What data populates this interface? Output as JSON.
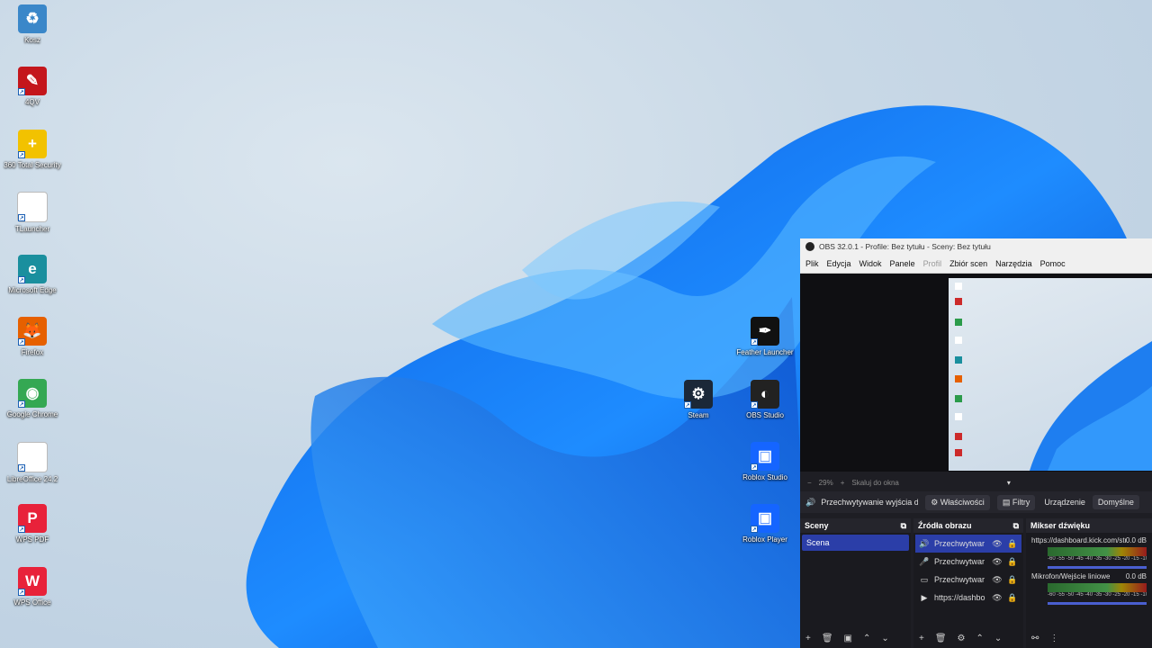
{
  "desktop": {
    "icons_left": [
      {
        "label": "Kosz",
        "icon": "recycle-bin-icon",
        "color": "#3a87c9"
      },
      {
        "label": "4QV",
        "icon": "pdf-reader-icon",
        "color": "#c4161c"
      },
      {
        "label": "360 Total Security",
        "icon": "shield-plus-icon",
        "color": "#f2c200"
      },
      {
        "label": "TLauncher",
        "icon": "file-icon",
        "color": "#ffffff"
      },
      {
        "label": "Microsoft Edge",
        "icon": "edge-icon",
        "color": "#1a8f9e"
      },
      {
        "label": "Firefox",
        "icon": "firefox-icon",
        "color": "#e66000"
      },
      {
        "label": "Google Chrome",
        "icon": "chrome-icon",
        "color": "#34a853"
      },
      {
        "label": "LibreOffice 24.2",
        "icon": "document-icon",
        "color": "#ffffff"
      },
      {
        "label": "WPS PDF",
        "icon": "wps-pdf-icon",
        "color": "#e8223a"
      },
      {
        "label": "WPS Office",
        "icon": "wps-office-icon",
        "color": "#e8223a"
      }
    ],
    "icons_right": [
      {
        "label": "Feather Launcher",
        "icon": "feather-icon",
        "color": "#111111"
      },
      {
        "label": "Steam",
        "icon": "steam-icon",
        "color": "#1b2838"
      },
      {
        "label": "OBS Studio",
        "icon": "obs-icon",
        "color": "#222222"
      },
      {
        "label": "Roblox Studio",
        "icon": "roblox-studio-icon",
        "color": "#1565ff"
      },
      {
        "label": "Roblox Player",
        "icon": "roblox-player-icon",
        "color": "#1565ff"
      }
    ]
  },
  "obs": {
    "title": "OBS 32.0.1 - Profile: Bez tytułu - Sceny: Bez tytułu",
    "menu": [
      "Plik",
      "Edycja",
      "Widok",
      "Panele",
      "Profil",
      "Zbiór scen",
      "Narzędzia",
      "Pomoc"
    ],
    "zoom": "29%",
    "zoom_mode": "Skaluj do okna",
    "source_bar": {
      "source_name": "Przechwytywanie wyjścia d",
      "properties": "Właściwości",
      "filters": "Filtry",
      "device": "Urządzenie",
      "default": "Domyślne"
    },
    "scenes": {
      "header": "Sceny",
      "items": [
        "Scena"
      ]
    },
    "sources": {
      "header": "Źródła obrazu",
      "items": [
        {
          "name": "Przechwytwar",
          "icon": "speaker-icon"
        },
        {
          "name": "Przechwytwar",
          "icon": "microphone-icon"
        },
        {
          "name": "Przechwytwar",
          "icon": "monitor-icon"
        },
        {
          "name": "https://dashbo",
          "icon": "play-icon"
        }
      ]
    },
    "mixer": {
      "header": "Mikser dźwięku",
      "channels": [
        {
          "name": "https://dashboard.kick.com/strea",
          "db": "0.0 dB"
        },
        {
          "name": "Mikrofon/Wejście liniowe",
          "db": "0.0 dB"
        }
      ],
      "ticks": "-60 -55 -50 -45 -40 -35 -30 -25 -20 -15 -10 -5 0"
    }
  }
}
